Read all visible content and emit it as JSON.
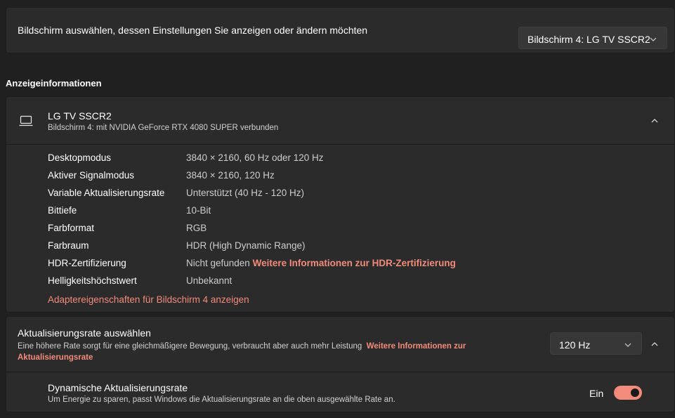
{
  "display_select": {
    "label": "Bildschirm auswählen, dessen Einstellungen Sie anzeigen oder ändern möchten",
    "selected": "Bildschirm 4: LG TV SSCR2"
  },
  "section_heading": "Anzeigeinformationen",
  "info": {
    "title": "LG TV SSCR2",
    "subtitle": "Bildschirm 4: mit NVIDIA GeForce RTX 4080 SUPER verbunden",
    "rows": [
      {
        "key": "Desktopmodus",
        "value": "3840 × 2160, 60 Hz oder 120 Hz"
      },
      {
        "key": "Aktiver Signalmodus",
        "value": "3840 × 2160, 120 Hz"
      },
      {
        "key": "Variable Aktualisierungsrate",
        "value": "Unterstützt (40 Hz - 120 Hz)"
      },
      {
        "key": "Bittiefe",
        "value": "10-Bit"
      },
      {
        "key": "Farbformat",
        "value": "RGB"
      },
      {
        "key": "Farbraum",
        "value": "HDR (High Dynamic Range)"
      },
      {
        "key": "HDR-Zertifizierung",
        "value": "Nicht gefunden",
        "link": "Weitere Informationen zur HDR-Zertifizierung"
      },
      {
        "key": "Helligkeitshöchstwert",
        "value": "Unbekannt"
      }
    ],
    "adapter_link": "Adaptereigenschaften für Bildschirm 4 anzeigen"
  },
  "refresh": {
    "title": "Aktualisierungsrate auswählen",
    "description": "Eine höhere Rate sorgt für eine gleichmäßigere Bewegung, verbraucht aber auch mehr Leistung",
    "link": "Weitere Informationen zur Aktualisierungsrate",
    "selected": "120 Hz"
  },
  "dynamic": {
    "title": "Dynamische Aktualisierungsrate",
    "description": "Um Energie zu sparen, passt Windows die Aktualisierungsrate an die oben ausgewählte Rate an.",
    "toggle_label": "Ein",
    "toggle_on": true
  },
  "colors": {
    "accent": "#f28b7b",
    "background": "#202020",
    "card": "#2b2b2b"
  },
  "icons": [
    "monitor-icon",
    "chevron-down-icon",
    "chevron-up-icon"
  ]
}
